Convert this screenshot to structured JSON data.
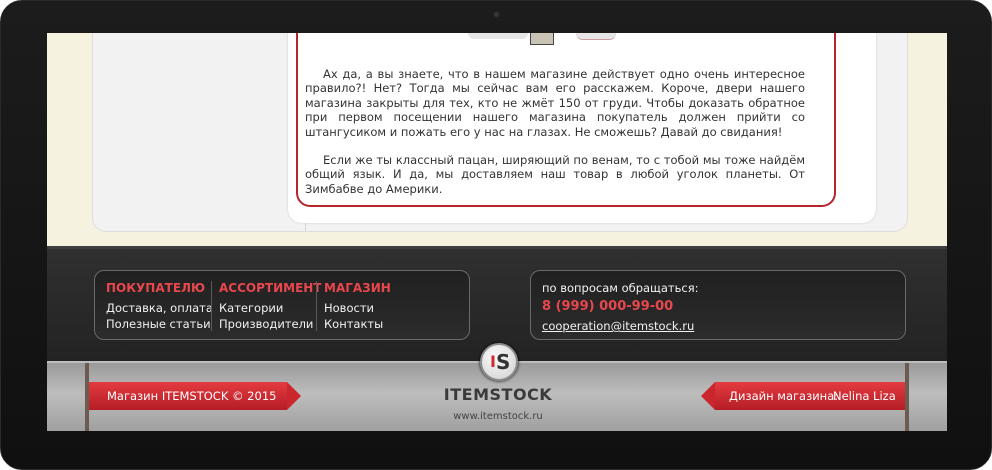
{
  "article": {
    "paragraph1": "Ах да, а вы знаете, что в нашем магазине действует одно очень интересное правило?! Нет? Тогда мы сейчас вам его расскажем. Короче, двери нашего магазина закрыты для тех, кто не жмёт 150 от груди. Чтобы доказать обратное при первом посещении нашего магазина покупатель должен прийти со штангусиком и пожать его у нас на глазах. Не сможешь? Давай до свидания!",
    "paragraph2": "Если же ты классный пацан, ширяющий по венам, то с тобой мы тоже найдём общий язык. И да, мы доставляем наш товар в любой уголок планеты. От Зимбабве до Америки."
  },
  "footer_nav": {
    "columns": [
      {
        "heading": "ПОКУПАТЕЛЮ",
        "links": [
          "Доставка, оплата",
          "Полезные статьи"
        ]
      },
      {
        "heading": "АССОРТИМЕНТ",
        "links": [
          "Категории",
          "Производители"
        ]
      },
      {
        "heading": "МАГАЗИН",
        "links": [
          "Новости",
          "Контакты"
        ]
      }
    ]
  },
  "contact": {
    "label": "по вопросам обращаться:",
    "phone": "8 (999) 000-99-00",
    "email": "cooperation@itemstock.ru"
  },
  "bottom_bar": {
    "copyright": "Магазин ITEMSTOCK © 2015",
    "design_label": "Дизайн магазина:",
    "designer": "Nelina Liza",
    "logo_text": "ITEMSTOCK",
    "logo_url": "www.itemstock.ru",
    "logo_letters": {
      "a": "I",
      "b": "S"
    }
  },
  "colors": {
    "accent": "#e8474d",
    "ribbon": "#c9262d",
    "article_border": "#b5262c"
  }
}
